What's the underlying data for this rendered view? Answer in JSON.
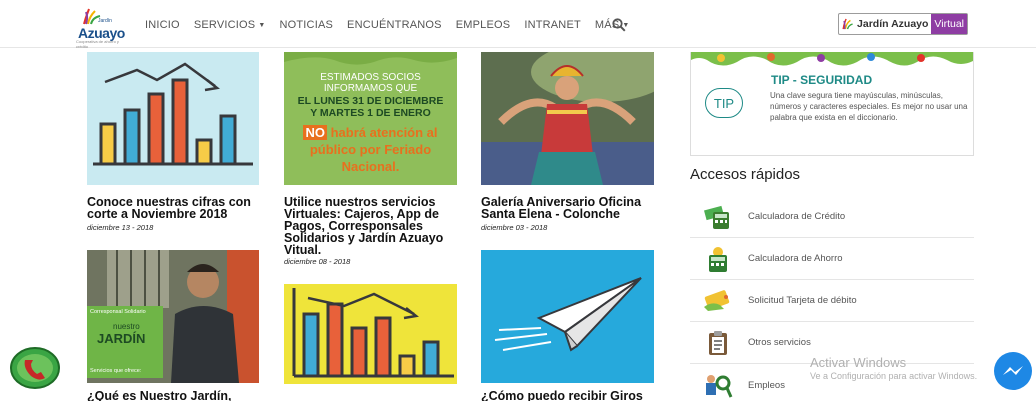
{
  "brand": {
    "logo_text": "Azuayo",
    "logo_small": "Jardín",
    "logo_tagline": "Cooperativa de ahorro y crédito",
    "colors": {
      "purple": "#8e3da3",
      "teal": "#1e8a86",
      "navy": "#1a4f8a"
    }
  },
  "nav": {
    "items": [
      "INICIO",
      "SERVICIOS",
      "NOTICIAS",
      "ENCUÉNTRANOS",
      "EMPLEOS",
      "INTRANET",
      "MÁS"
    ],
    "virtual_brand": "Jardín Azuayo",
    "virtual_tag": "Virtual"
  },
  "news": [
    {
      "title": "Conoce nuestras cifras con corte a Noviembre 2018",
      "date": "diciembre 13 - 2018"
    },
    {
      "title": "Utilice nuestros servicios Virtuales: Cajeros, App de Pagos, Corresponsales Solidarios y Jardín Azuayo Vitual.",
      "date": "diciembre 08 - 2018"
    },
    {
      "title": "Galería Aniversario Oficina Santa Elena - Colonche",
      "date": "diciembre 03 - 2018"
    },
    {
      "title": "¿Qué es Nuestro Jardín,"
    },
    {
      "title": ""
    },
    {
      "title": "¿Cómo puedo recibir Giros"
    }
  ],
  "poster": {
    "line1": "ESTIMADOS SOCIOS",
    "line2": "INFORMAMOS QUE",
    "line3": "EL LUNES 31 DE DICIEMBRE",
    "line4": "Y MARTES 1 DE ENERO",
    "no": "NO",
    "line5": "habrá atención al",
    "line6": "público por Feriado",
    "line7": "Nacional."
  },
  "photo_tile": {
    "sign_top": "Corresponsal Solidario",
    "sign_mid": "nuestro",
    "sign_big": "JARDÍN",
    "sign_bottom": "Servicios que ofrece:"
  },
  "tip": {
    "badge": "TIP",
    "title": "TIP - SEGURIDAD",
    "body": "Una clave segura tiene mayúsculas, minúsculas, números y caracteres especiales. Es mejor no usar una palabra que exista en el diccionario."
  },
  "quick_access": {
    "title": "Accesos rápidos",
    "items": [
      {
        "label": "Calculadora de Crédito",
        "icon": "money-calculator-icon"
      },
      {
        "label": "Calculadora de Ahorro",
        "icon": "piggy-calculator-icon"
      },
      {
        "label": "Solicitud Tarjeta de débito",
        "icon": "debit-card-icon"
      },
      {
        "label": "Otros servicios",
        "icon": "clipboard-icon"
      },
      {
        "label": "Empleos",
        "icon": "job-search-icon"
      }
    ]
  },
  "watermark": {
    "line1": "Activar Windows",
    "line2": "Ve a Configuración para activar Windows."
  }
}
